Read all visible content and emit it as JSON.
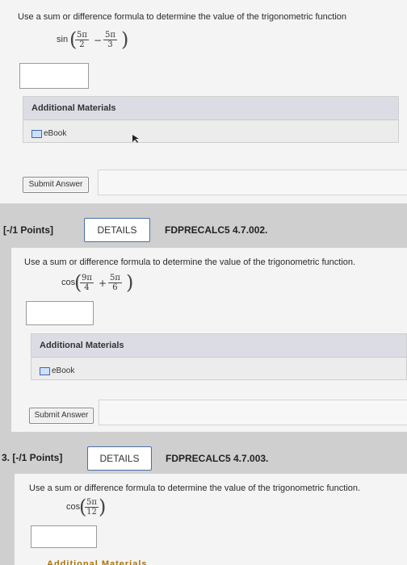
{
  "q1": {
    "prompt": "Use a sum or difference formula to determine the value of the trigonometric function",
    "func": "sin",
    "frac1_num": "5π",
    "frac1_den": "2",
    "operator": "−",
    "frac2_num": "5π",
    "frac2_den": "3",
    "materials_title": "Additional Materials",
    "ebook_label": "eBook",
    "submit_label": "Submit Answer"
  },
  "q2": {
    "points": "[-/1 Points]",
    "details_label": "DETAILS",
    "problem_id": "FDPRECALC5 4.7.002.",
    "prompt": "Use a sum or difference formula to determine the value of the trigonometric function.",
    "func": "cos",
    "frac1_num": "9π",
    "frac1_den": "4",
    "operator": "+",
    "frac2_num": "5π",
    "frac2_den": "6",
    "materials_title": "Additional Materials",
    "ebook_label": "eBook",
    "submit_label": "Submit Answer"
  },
  "q3": {
    "points": "3. [-/1 Points]",
    "details_label": "DETAILS",
    "problem_id": "FDPRECALC5 4.7.003.",
    "prompt": "Use a sum or difference formula to determine the value of the trigonometric function.",
    "func": "cos",
    "frac1_num": "5π",
    "frac1_den": "12",
    "materials_title": "Additional Materials"
  },
  "colors": {
    "panel": "#f4f4f4",
    "page": "#cfcfcf",
    "details_border": "#4b6fa8",
    "materials_head": "#dcdde4"
  }
}
